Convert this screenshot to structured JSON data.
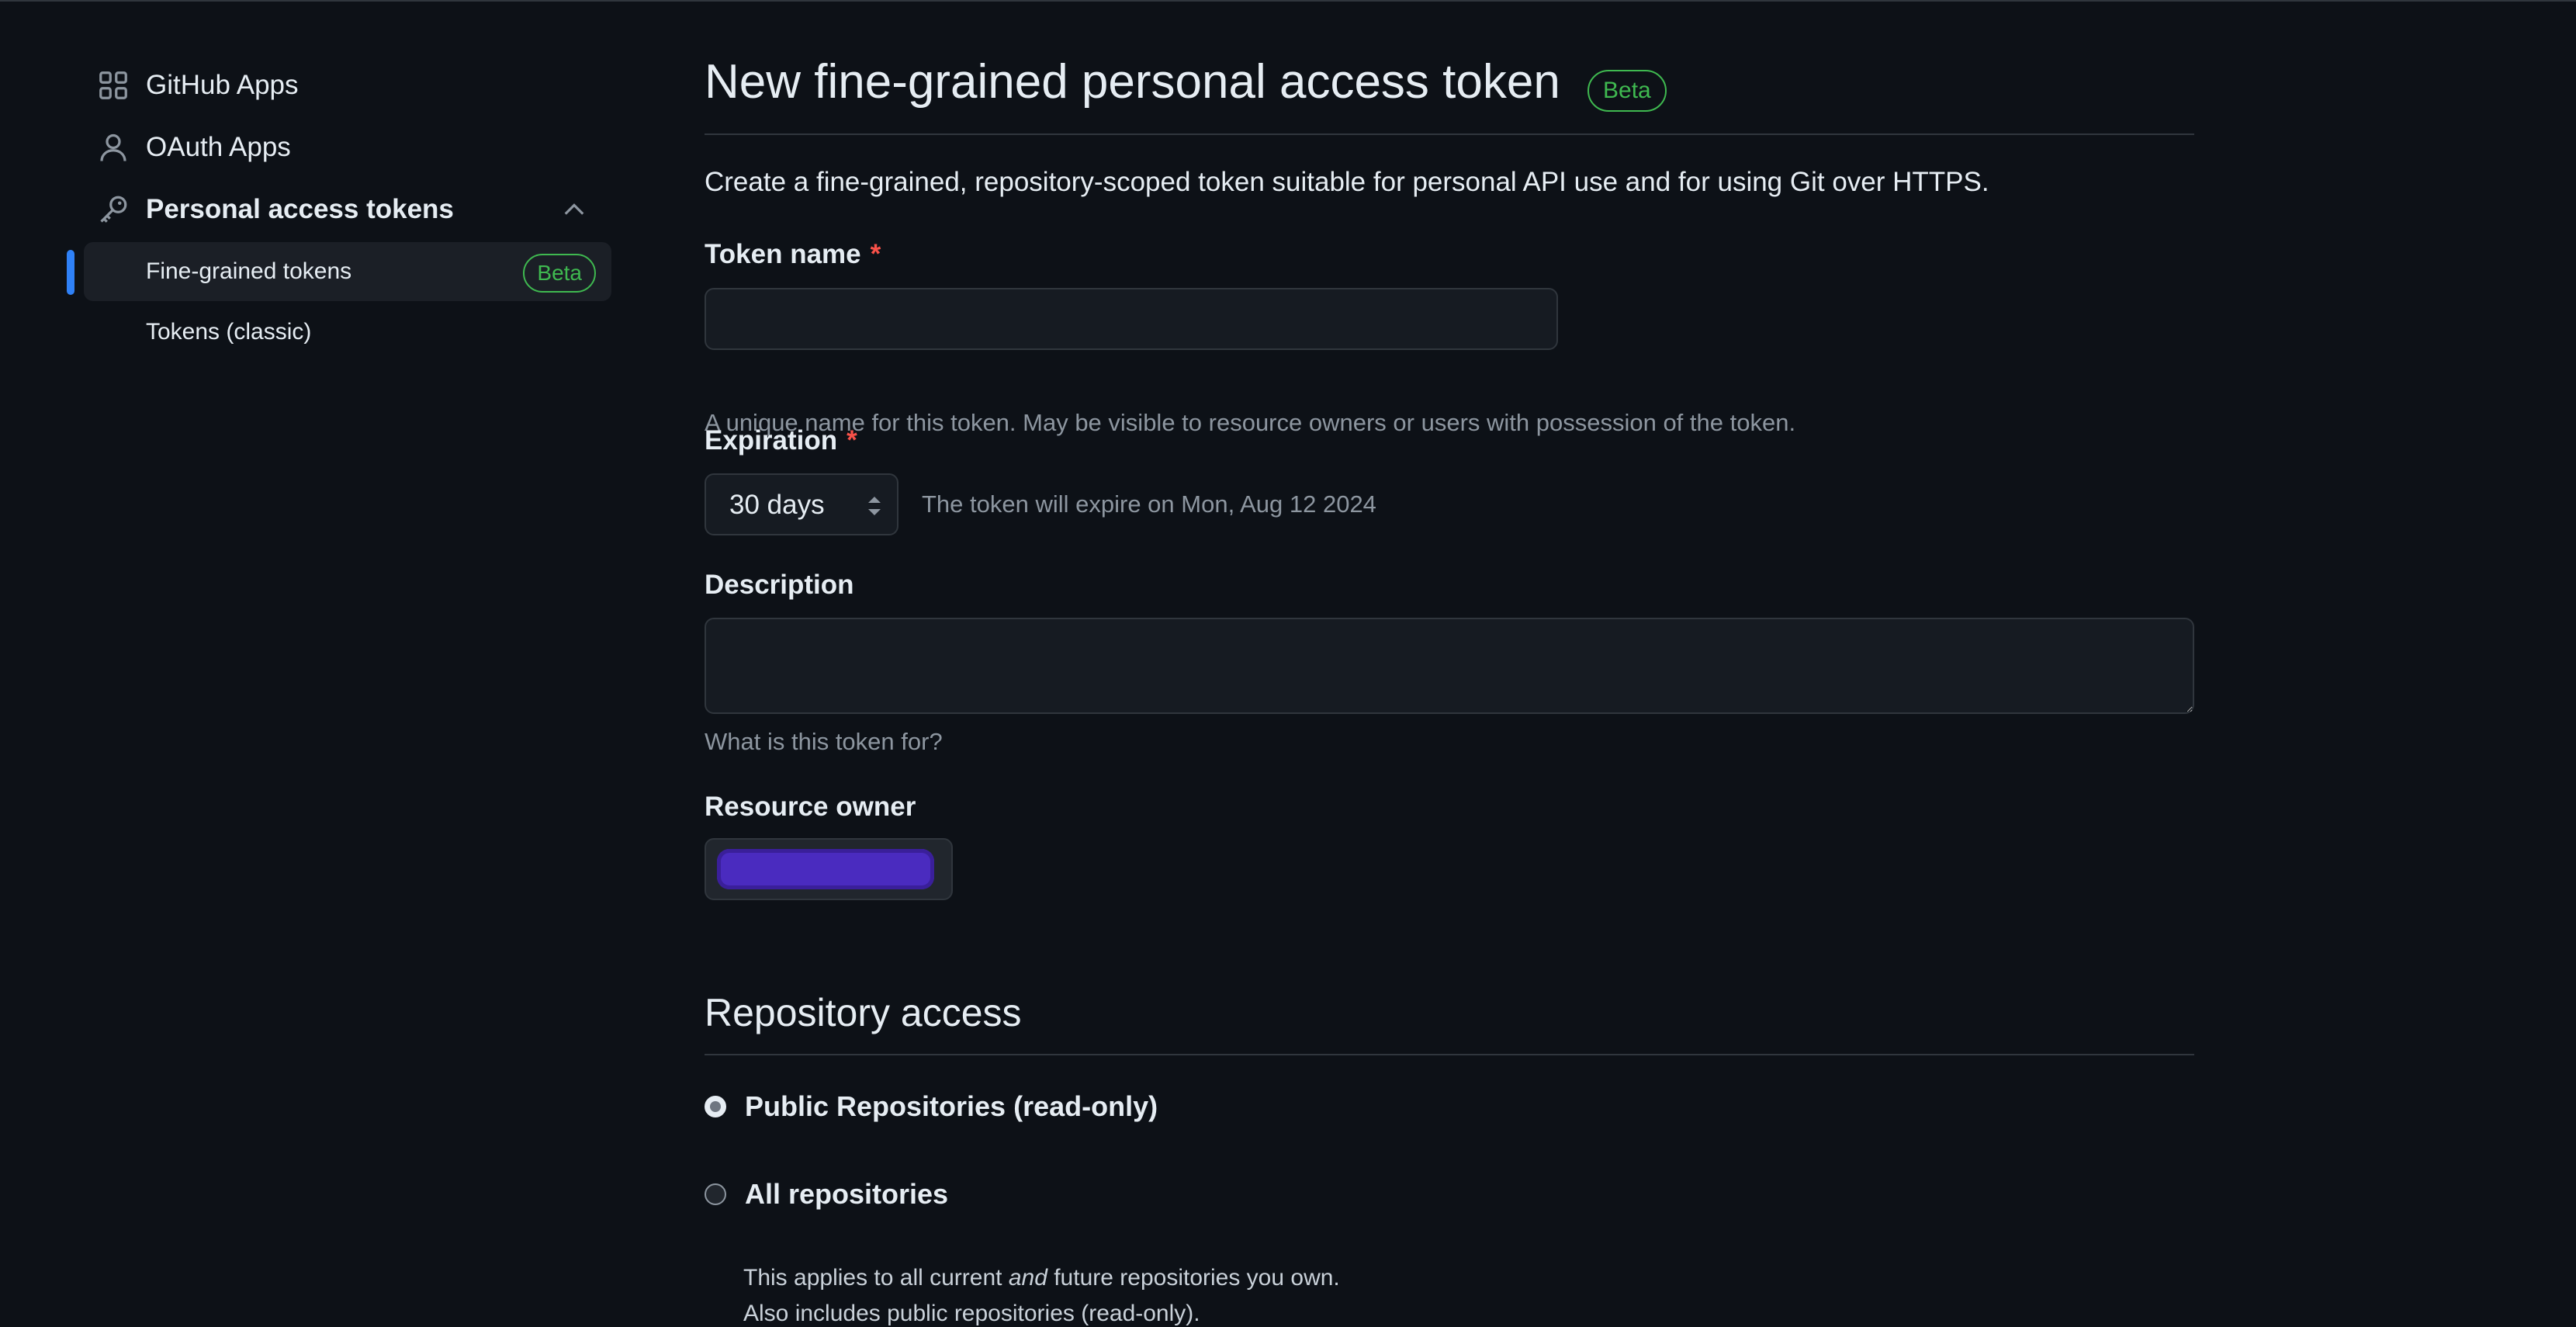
{
  "sidebar": {
    "items": [
      {
        "label": "GitHub Apps",
        "icon": "apps-grid-icon"
      },
      {
        "label": "OAuth Apps",
        "icon": "person-icon"
      },
      {
        "label": "Personal access tokens",
        "icon": "key-icon",
        "expanded": true
      }
    ],
    "sub_items": [
      {
        "label": "Fine-grained tokens",
        "badge": "Beta",
        "active": true
      },
      {
        "label": "Tokens (classic)"
      }
    ]
  },
  "main": {
    "title": "New fine-grained personal access token",
    "title_badge": "Beta",
    "intro": "Create a fine-grained, repository-scoped token suitable for personal API use and for using Git over HTTPS.",
    "token_name": {
      "label": "Token name",
      "required_mark": "*",
      "value": "",
      "hint": "A unique name for this token. May be visible to resource owners or users with possession of the token."
    },
    "expiration": {
      "label": "Expiration",
      "required_mark": "*",
      "selected": "30 days",
      "note": "The token will expire on Mon, Aug 12 2024"
    },
    "description": {
      "label": "Description",
      "value": "",
      "hint": "What is this token for?"
    },
    "resource_owner": {
      "label": "Resource owner"
    },
    "repository_access": {
      "title": "Repository access",
      "options": [
        {
          "label": "Public Repositories (read-only)",
          "checked": true
        },
        {
          "label": "All repositories",
          "checked": false,
          "desc_1a": "This applies to all current ",
          "desc_1b": "and",
          "desc_1c": " future repositories you own.",
          "desc_2": "Also includes public repositories (read-only)."
        }
      ]
    }
  },
  "colors": {
    "background": "#0d1117",
    "accent_blue": "#2f81f7",
    "beta_green": "#3fb950",
    "required_red": "#f85149",
    "redaction_purple": "#4a2bbf"
  }
}
